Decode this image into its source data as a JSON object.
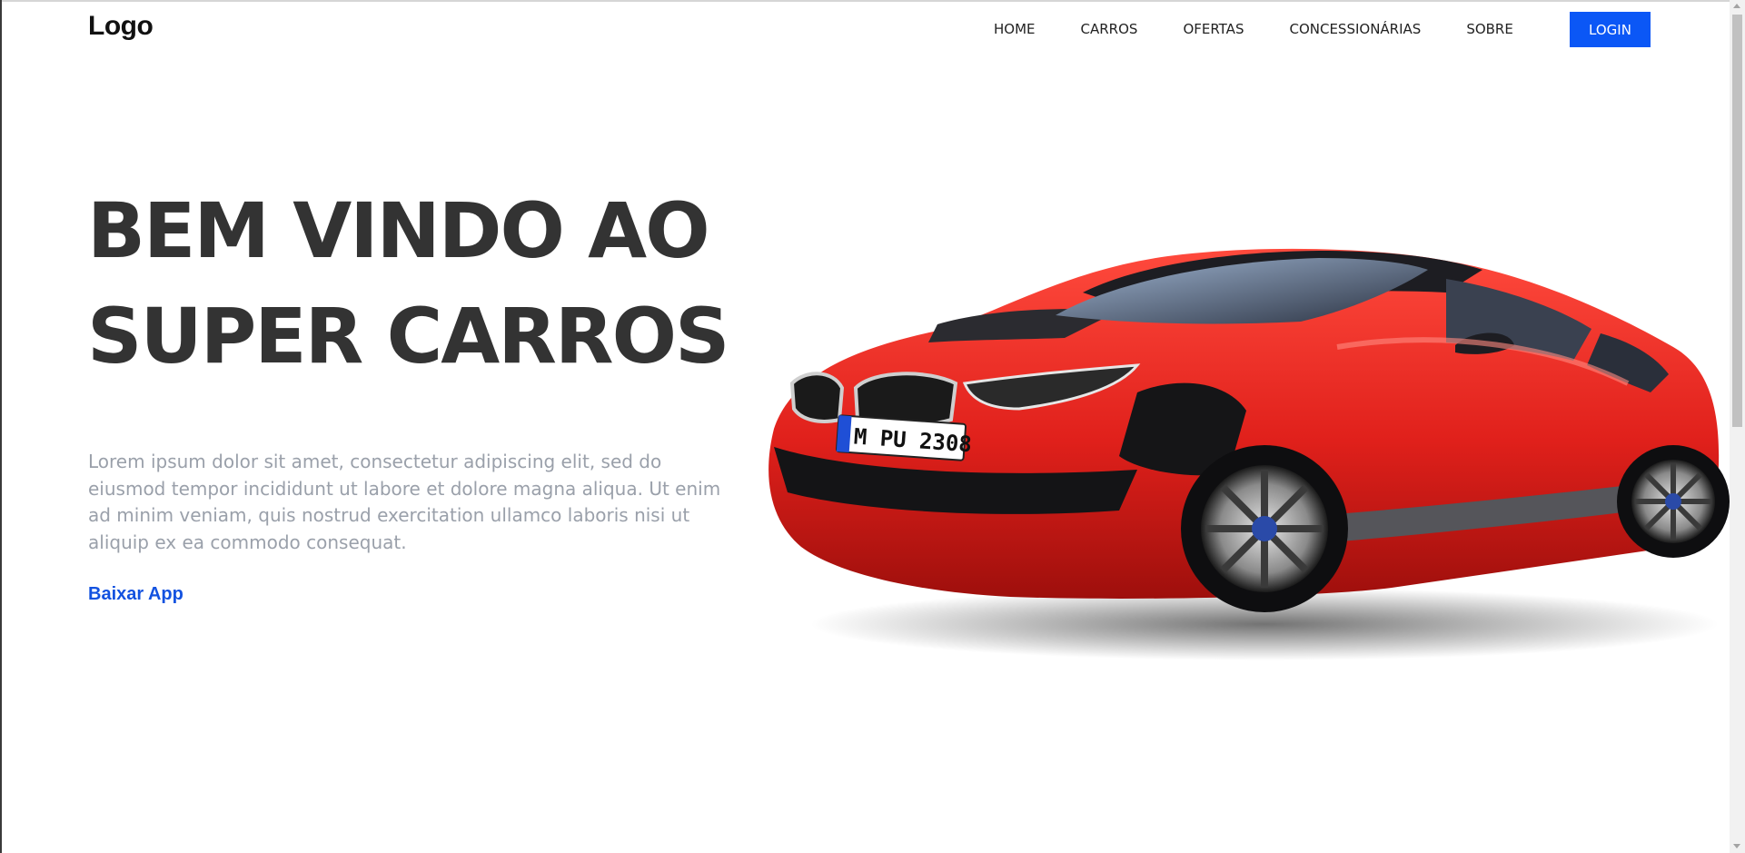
{
  "header": {
    "logo": "Logo",
    "nav": [
      "HOME",
      "CARROS",
      "OFERTAS",
      "CONCESSIONÁRIAS",
      "SOBRE"
    ],
    "login_label": "LOGIN"
  },
  "hero": {
    "title_line1": "BEM VINDO AO",
    "title_line2": "SUPER CARROS",
    "description": "Lorem ipsum dolor sit amet, consectetur adipiscing elit, sed do eiusmod tempor incididunt ut labore et dolore magna aliqua. Ut enim ad minim veniam, quis nostrud exercitation ullamco laboris nisi ut aliquip ex ea commodo consequat.",
    "cta_label": "Baixar App"
  },
  "car": {
    "plate": "M PU 2308"
  },
  "colors": {
    "accent": "#0b57f6",
    "link": "#1352e0",
    "title": "#333333",
    "body_text": "#9aa0aa",
    "car_red": "#e0201b"
  }
}
